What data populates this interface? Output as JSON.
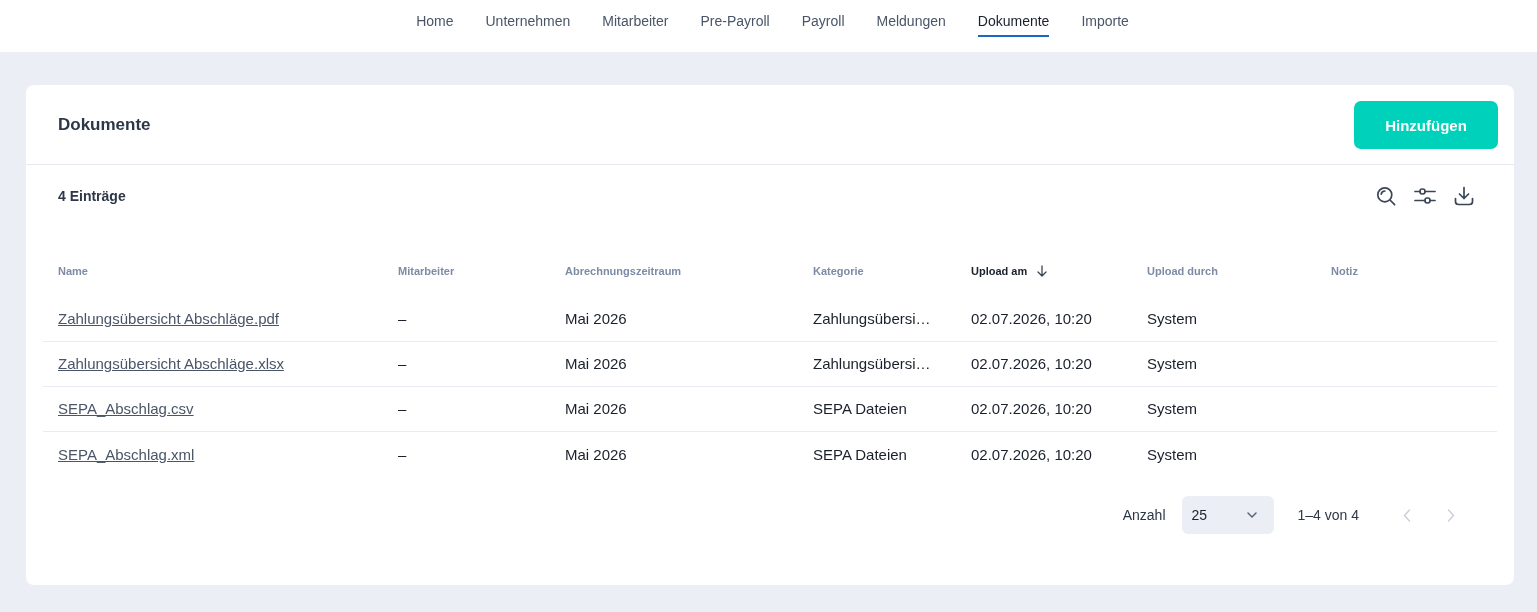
{
  "nav": {
    "items": [
      {
        "label": "Home",
        "selected": false
      },
      {
        "label": "Unternehmen",
        "selected": false
      },
      {
        "label": "Mitarbeiter",
        "selected": false
      },
      {
        "label": "Pre-Payroll",
        "selected": false
      },
      {
        "label": "Payroll",
        "selected": false
      },
      {
        "label": "Meldungen",
        "selected": false
      },
      {
        "label": "Dokumente",
        "selected": true
      },
      {
        "label": "Importe",
        "selected": false
      }
    ]
  },
  "card": {
    "title": "Dokumente",
    "add_button": "Hinzufügen"
  },
  "toolbar": {
    "count": "4 Einträge"
  },
  "table": {
    "columns": [
      {
        "label": "Name",
        "sorted": false
      },
      {
        "label": "Mitarbeiter",
        "sorted": false
      },
      {
        "label": "Abrechnungszeitraum",
        "sorted": false
      },
      {
        "label": "Kategorie",
        "sorted": false
      },
      {
        "label": "Upload am",
        "sorted": true
      },
      {
        "label": "Upload durch",
        "sorted": false
      },
      {
        "label": "Notiz",
        "sorted": false
      }
    ],
    "rows": [
      {
        "cells": [
          "Zahlungsübersicht Abschläge.pdf",
          "–",
          "Mai 2026",
          "Zahlungsübersi…",
          "02.07.2026, 10:20",
          "System"
        ]
      },
      {
        "cells": [
          "Zahlungsübersicht Abschläge.xlsx",
          "–",
          "Mai 2026",
          "Zahlungsübersi…",
          "02.07.2026, 10:20",
          "System"
        ]
      },
      {
        "cells": [
          "SEPA_Abschlag.csv",
          "–",
          "Mai 2026",
          "SEPA Dateien",
          "02.07.2026, 10:20",
          "System"
        ]
      },
      {
        "cells": [
          "SEPA_Abschlag.xml",
          "–",
          "Mai 2026",
          "SEPA Dateien",
          "02.07.2026, 10:20",
          "System"
        ]
      }
    ]
  },
  "pagination": {
    "label": "Anzahl",
    "page_size": "25",
    "range": "1–4 von 4",
    "prev": {
      "disabled": true
    },
    "next": {
      "disabled": true
    }
  }
}
